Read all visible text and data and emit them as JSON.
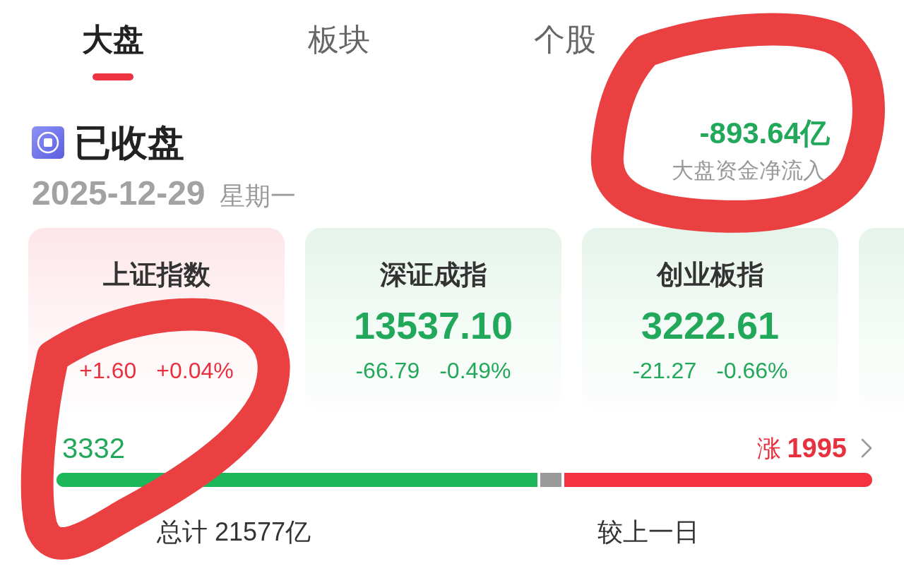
{
  "tabs": [
    {
      "label": "大盘",
      "selected": true
    },
    {
      "label": "板块",
      "selected": false
    },
    {
      "label": "个股",
      "selected": false
    }
  ],
  "status": {
    "label": "已收盘",
    "date": "2025-12-29",
    "weekday": "星期一"
  },
  "net_flow": {
    "value": "-893.64亿",
    "label": "大盘资金净流入",
    "kind": "fall"
  },
  "index_cards": [
    {
      "kind": "rise",
      "name": "上证指数",
      "change": "+1.60",
      "percent": "+0.04%"
    },
    {
      "kind": "fall",
      "name": "深证成指",
      "value": "13537.10",
      "change": "-66.79",
      "percent": "-0.49%"
    },
    {
      "kind": "fall",
      "name": "创业板指",
      "value": "3222.61",
      "change": "-21.27",
      "percent": "-0.66%"
    },
    {
      "kind": "fall"
    }
  ],
  "breadth": {
    "fall_count": "3332",
    "rise_label": "涨",
    "rise_count": "1995",
    "fills": [
      {
        "kind": "fall",
        "level": 0.593
      },
      {
        "kind": "rise",
        "level": 0.381
      }
    ]
  },
  "turnover": {
    "total": "总计 21577亿",
    "compare_label": "较上一日"
  }
}
